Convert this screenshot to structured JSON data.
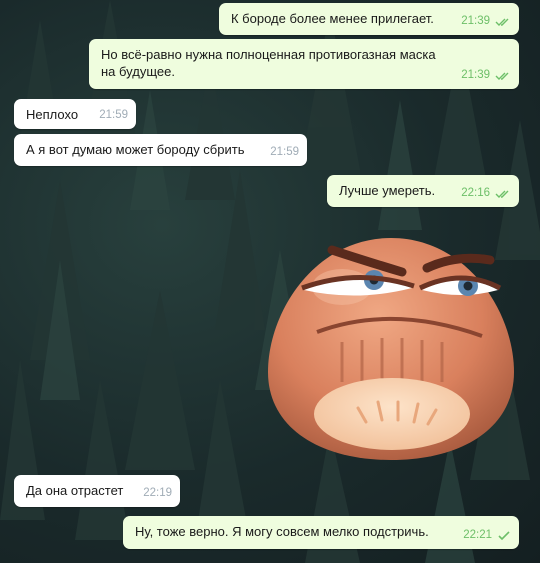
{
  "chat": {
    "messages": [
      {
        "dir": "out",
        "text": "К бороде более менее прилегает.",
        "time": "21:39",
        "status": "read"
      },
      {
        "dir": "out",
        "text": "Но всё-равно нужна полноценная противогазная маска на будущее.",
        "time": "21:39",
        "status": "read"
      },
      {
        "dir": "in",
        "text": "Неплохо",
        "time": "21:59"
      },
      {
        "dir": "in",
        "text": "А я вот думаю может бороду сбрить",
        "time": "21:59"
      },
      {
        "dir": "out",
        "text": "Лучше умереть.",
        "time": "22:16",
        "status": "read"
      },
      {
        "dir": "out",
        "type": "sticker",
        "sticker": "grumpy-face-sticker"
      },
      {
        "dir": "in",
        "text": "Да она отрастет",
        "time": "22:19"
      },
      {
        "dir": "out",
        "text": "Ну, тоже верно. Я могу совсем мелко подстричь.",
        "time": "22:21",
        "status": "sent"
      }
    ]
  },
  "colors": {
    "outgoing_bubble": "#effdde",
    "incoming_bubble": "#ffffff",
    "check_color": "#6dbf68",
    "time_incoming": "#a0acb6",
    "background": "#1b2b2c"
  },
  "icons": {
    "read": "double-check-icon",
    "sent": "single-check-icon"
  }
}
